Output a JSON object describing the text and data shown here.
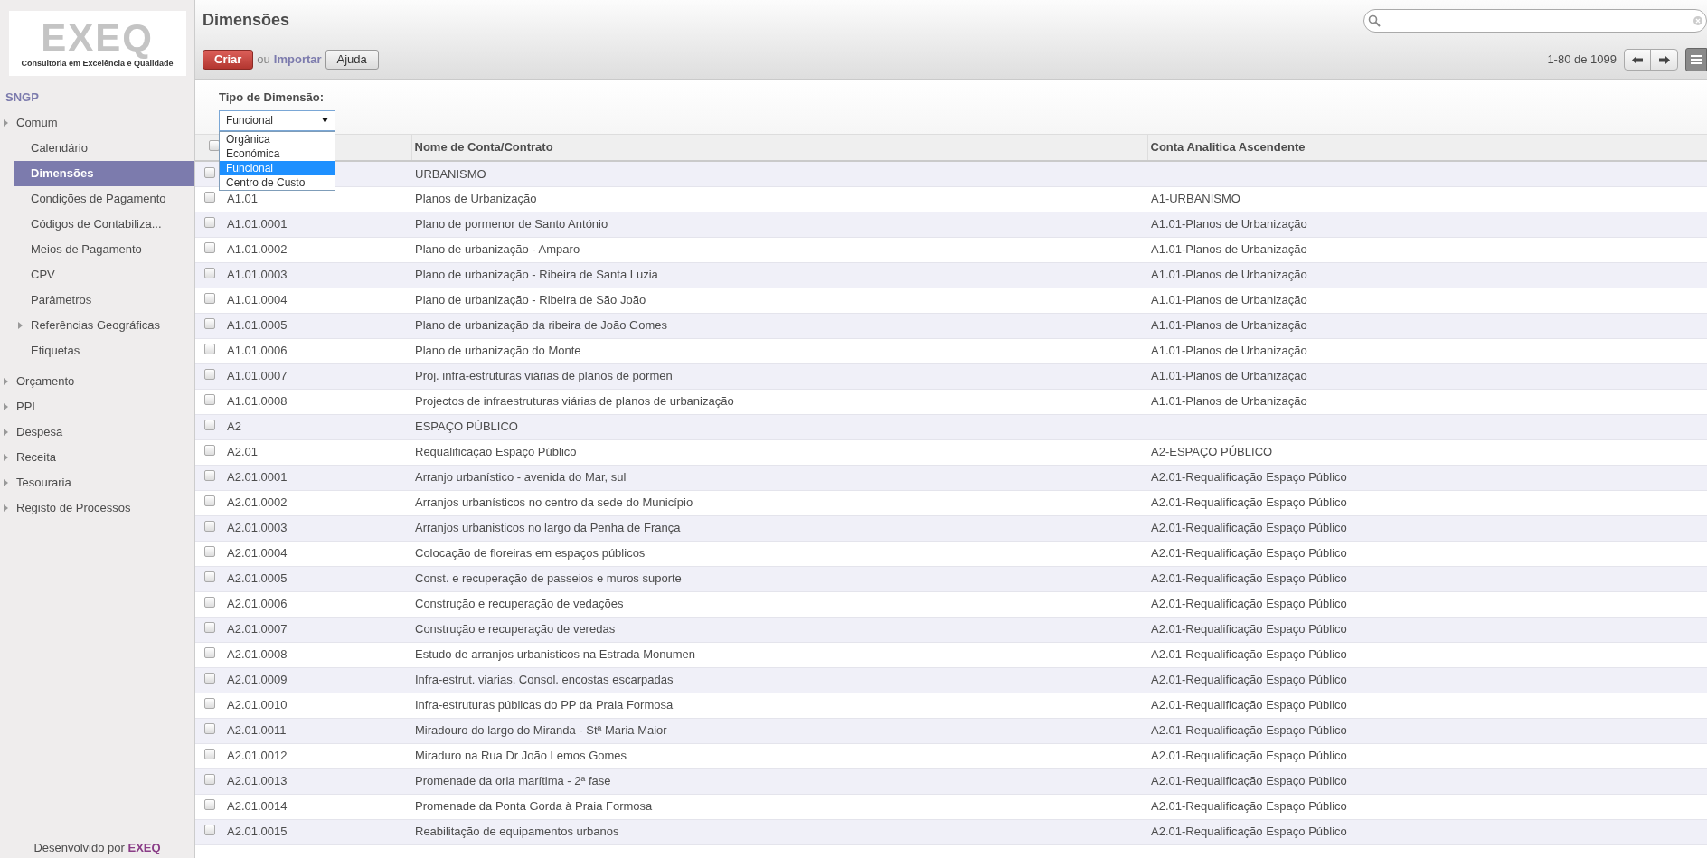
{
  "logo": {
    "wordmark": "EXEQ",
    "tagline": "Consultoria em Excelência e Qualidade"
  },
  "sidebar": {
    "app_title": "SNGP",
    "items": [
      {
        "label": "Comum",
        "arrow": true,
        "selected": false,
        "children": [
          {
            "label": "Calendário",
            "arrow": false,
            "selected": false
          },
          {
            "label": "Dimensões",
            "arrow": false,
            "selected": true
          },
          {
            "label": "Condições de Pagamento",
            "arrow": false,
            "selected": false
          },
          {
            "label": "Códigos de Contabiliza...",
            "arrow": false,
            "selected": false
          },
          {
            "label": "Meios de Pagamento",
            "arrow": false,
            "selected": false
          },
          {
            "label": "CPV",
            "arrow": false,
            "selected": false
          },
          {
            "label": "Parâmetros",
            "arrow": false,
            "selected": false
          },
          {
            "label": "Referências Geográficas",
            "arrow": true,
            "selected": false
          },
          {
            "label": "Etiquetas",
            "arrow": false,
            "selected": false
          }
        ]
      },
      {
        "label": "Orçamento",
        "arrow": true,
        "selected": false
      },
      {
        "label": "PPI",
        "arrow": true,
        "selected": false
      },
      {
        "label": "Despesa",
        "arrow": true,
        "selected": false
      },
      {
        "label": "Receita",
        "arrow": true,
        "selected": false
      },
      {
        "label": "Tesouraria",
        "arrow": true,
        "selected": false
      },
      {
        "label": "Registo de Processos",
        "arrow": true,
        "selected": false
      }
    ],
    "footer": {
      "text": "Desenvolvido por",
      "brand": "EXEQ"
    }
  },
  "header": {
    "title": "Dimensões",
    "create_button": "Criar",
    "or_text": "ou",
    "import_link": "Importar",
    "help_button": "Ajuda",
    "pager": "1-80 de 1099"
  },
  "filter": {
    "label": "Tipo de Dimensão:",
    "value": "Funcional",
    "options": [
      {
        "label": "Orgânica",
        "selected": false
      },
      {
        "label": "Económica",
        "selected": false
      },
      {
        "label": "Funcional",
        "selected": true
      },
      {
        "label": "Centro de Custo",
        "selected": false
      }
    ]
  },
  "table": {
    "all_checked": false,
    "columns": [
      "Nome de Conta/Contrato",
      "Conta Analitica Ascendente"
    ],
    "rows": [
      {
        "name": "URBANISMO",
        "checked": false
      },
      {
        "code": "A1.01",
        "name": "Planos de Urbanização",
        "parent": "A1-URBANISMO",
        "checked": false
      },
      {
        "code": "A1.01.0001",
        "name": "Plano de pormenor de Santo António",
        "parent": "A1.01-Planos de Urbanização",
        "checked": false
      },
      {
        "code": "A1.01.0002",
        "name": "Plano de urbanização - Amparo",
        "parent": "A1.01-Planos de Urbanização",
        "checked": false
      },
      {
        "code": "A1.01.0003",
        "name": "Plano de urbanização - Ribeira de Santa Luzia",
        "parent": "A1.01-Planos de Urbanização",
        "checked": false
      },
      {
        "code": "A1.01.0004",
        "name": "Plano de urbanização - Ribeira de São João",
        "parent": "A1.01-Planos de Urbanização",
        "checked": false
      },
      {
        "code": "A1.01.0005",
        "name": "Plano de urbanização da ribeira de João Gomes",
        "parent": "A1.01-Planos de Urbanização",
        "checked": false
      },
      {
        "code": "A1.01.0006",
        "name": "Plano de urbanização do Monte",
        "parent": "A1.01-Planos de Urbanização",
        "checked": false
      },
      {
        "code": "A1.01.0007",
        "name": "Proj. infra-estruturas viárias de planos de pormen",
        "parent": "A1.01-Planos de Urbanização",
        "checked": false
      },
      {
        "code": "A1.01.0008",
        "name": "Projectos de infraestruturas viárias de planos de urbanização",
        "parent": "A1.01-Planos de Urbanização",
        "checked": false
      },
      {
        "code": "A2",
        "name": "ESPAÇO PÚBLICO",
        "checked": false
      },
      {
        "code": "A2.01",
        "name": "Requalificação Espaço Público",
        "parent": "A2-ESPAÇO PÚBLICO",
        "checked": false
      },
      {
        "code": "A2.01.0001",
        "name": "Arranjo urbanístico - avenida do Mar, sul",
        "parent": "A2.01-Requalificação Espaço Público",
        "checked": false
      },
      {
        "code": "A2.01.0002",
        "name": "Arranjos urbanísticos no centro da sede do Município",
        "parent": "A2.01-Requalificação Espaço Público",
        "checked": false
      },
      {
        "code": "A2.01.0003",
        "name": "Arranjos urbanisticos no largo da Penha de França",
        "parent": "A2.01-Requalificação Espaço Público",
        "checked": false
      },
      {
        "code": "A2.01.0004",
        "name": "Colocação de floreiras em espaços públicos",
        "parent": "A2.01-Requalificação Espaço Público",
        "checked": false
      },
      {
        "code": "A2.01.0005",
        "name": "Const. e recuperação de passeios e muros suporte",
        "parent": "A2.01-Requalificação Espaço Público",
        "checked": false
      },
      {
        "code": "A2.01.0006",
        "name": "Construção e recuperação de vedações",
        "parent": "A2.01-Requalificação Espaço Público",
        "checked": false
      },
      {
        "code": "A2.01.0007",
        "name": "Construção e recuperação de veredas",
        "parent": "A2.01-Requalificação Espaço Público",
        "checked": false
      },
      {
        "code": "A2.01.0008",
        "name": "Estudo de arranjos urbanisticos na Estrada Monumen",
        "parent": "A2.01-Requalificação Espaço Público",
        "checked": false
      },
      {
        "code": "A2.01.0009",
        "name": "Infra-estrut. viarias, Consol. encostas escarpadas",
        "parent": "A2.01-Requalificação Espaço Público",
        "checked": false
      },
      {
        "code": "A2.01.0010",
        "name": "Infra-estruturas públicas do PP da Praia Formosa",
        "parent": "A2.01-Requalificação Espaço Público",
        "checked": false
      },
      {
        "code": "A2.01.0011",
        "name": "Miradouro do largo do Miranda - Stª Maria Maior",
        "parent": "A2.01-Requalificação Espaço Público",
        "checked": false
      },
      {
        "code": "A2.01.0012",
        "name": "Miraduro na Rua Dr João Lemos Gomes",
        "parent": "A2.01-Requalificação Espaço Público",
        "checked": false
      },
      {
        "code": "A2.01.0013",
        "name": "Promenade da orla marítima - 2ª fase",
        "parent": "A2.01-Requalificação Espaço Público",
        "checked": false
      },
      {
        "code": "A2.01.0014",
        "name": "Promenade da Ponta Gorda à Praia Formosa",
        "parent": "A2.01-Requalificação Espaço Público",
        "checked": false
      },
      {
        "code": "A2.01.0015",
        "name": "Reabilitação de equipamentos urbanos",
        "parent": "A2.01-Requalificação Espaço Público",
        "checked": false
      }
    ]
  }
}
